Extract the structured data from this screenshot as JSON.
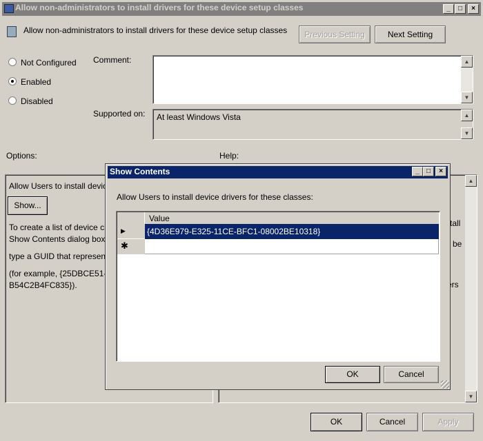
{
  "window": {
    "title": "Allow non-administrators to install drivers for these device setup classes"
  },
  "header": {
    "setting_name": "Allow non-administrators to install drivers for these device setup classes",
    "previous_label": "Previous Setting",
    "next_label": "Next Setting"
  },
  "state": {
    "options": [
      "Not Configured",
      "Enabled",
      "Disabled"
    ],
    "selected": "Enabled"
  },
  "comment": {
    "label": "Comment:",
    "value": ""
  },
  "supported": {
    "label": "Supported on:",
    "value": "At least Windows Vista"
  },
  "options_label": "Options:",
  "help_label": "Help:",
  "options_pane": {
    "line1": "Allow Users to install devic",
    "show_label": "Show...",
    "p1a": "To create a list of device cl",
    "p1b": "Show Contents dialog box",
    "p2": "type a GUID that represent",
    "p3a": "(for example, {25DBCE51-",
    "p3b": "B54C2B4FC835})."
  },
  "help_pane": {
    "f1": "tall",
    "f2": "be",
    "f3": "ers"
  },
  "dialog": {
    "title": "Show Contents",
    "prompt": "Allow Users to install device drivers for these classes:",
    "column": "Value",
    "rows": [
      "{4D36E979-E325-11CE-BFC1-08002BE10318}"
    ],
    "ok_label": "OK",
    "cancel_label": "Cancel"
  },
  "footer": {
    "ok_label": "OK",
    "cancel_label": "Cancel",
    "apply_label": "Apply"
  },
  "colors": {
    "dialog_title": "#0a246a",
    "selection": "#0a246a",
    "inactive_title": "#808080"
  }
}
